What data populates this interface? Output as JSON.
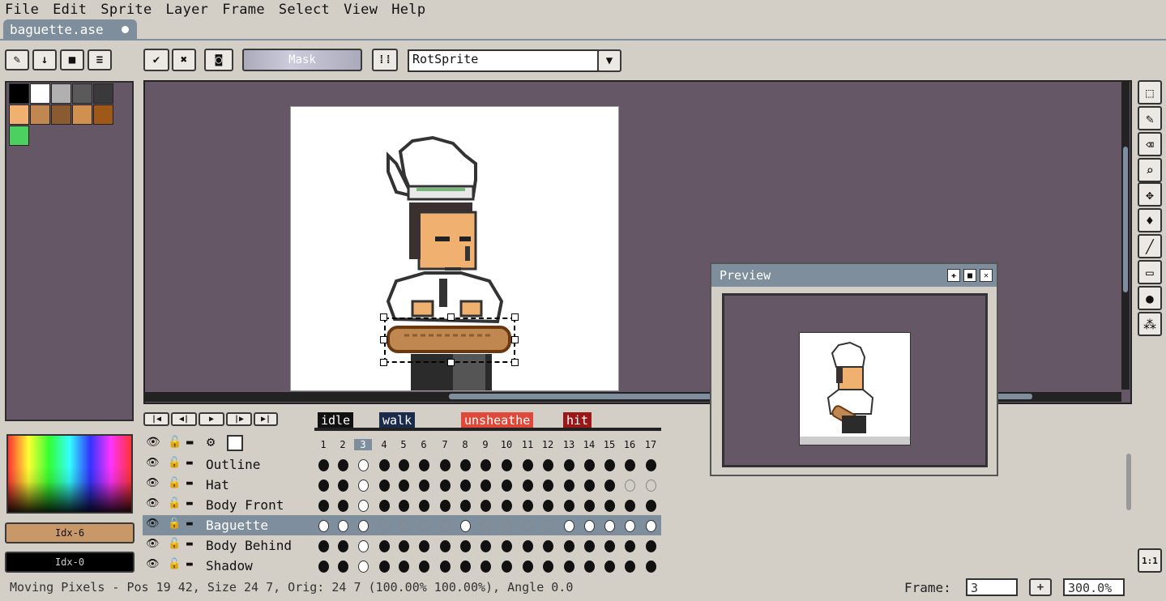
{
  "menu": [
    "File",
    "Edit",
    "Sprite",
    "Layer",
    "Frame",
    "Select",
    "View",
    "Help"
  ],
  "tab": {
    "title": "baguette.ase"
  },
  "toolbar": {
    "mask_label": "Mask",
    "algorithm": "RotSprite"
  },
  "preview": {
    "title": "Preview"
  },
  "animation_tags": [
    {
      "label": "idle",
      "color": "#111111"
    },
    {
      "label": "walk",
      "color": "#1a2a4a"
    },
    {
      "label": "unsheathe",
      "color": "#e0483a"
    },
    {
      "label": "hit",
      "color": "#9a1818"
    }
  ],
  "frames": [
    "1",
    "2",
    "3",
    "4",
    "5",
    "6",
    "7",
    "8",
    "9",
    "10",
    "11",
    "12",
    "13",
    "14",
    "15",
    "16",
    "17"
  ],
  "layers": [
    {
      "name": "Outline"
    },
    {
      "name": "Hat"
    },
    {
      "name": "Body Front"
    },
    {
      "name": "Baguette"
    },
    {
      "name": "Body Behind"
    },
    {
      "name": "Shadow"
    }
  ],
  "color_buttons": {
    "fg": "Idx-6",
    "bg": "Idx-0"
  },
  "status": {
    "message": "Moving Pixels - Pos 19 42, Size 24 7, Orig:  24   7 (100.00% 100.00%), Angle 0.0",
    "frame_label": "Frame:",
    "frame_value": "3",
    "plus": "+",
    "zoom": "300.0%"
  },
  "ratio_button": "1:1",
  "palette": {
    "colors": [
      "#000000",
      "#ffffff",
      "#b0b0b0",
      "#5a5a5a",
      "#3a3a3a",
      "#f0b070",
      "#c08850",
      "#8a5a30",
      "#d09050",
      "#a05818",
      "#4cd060"
    ]
  }
}
